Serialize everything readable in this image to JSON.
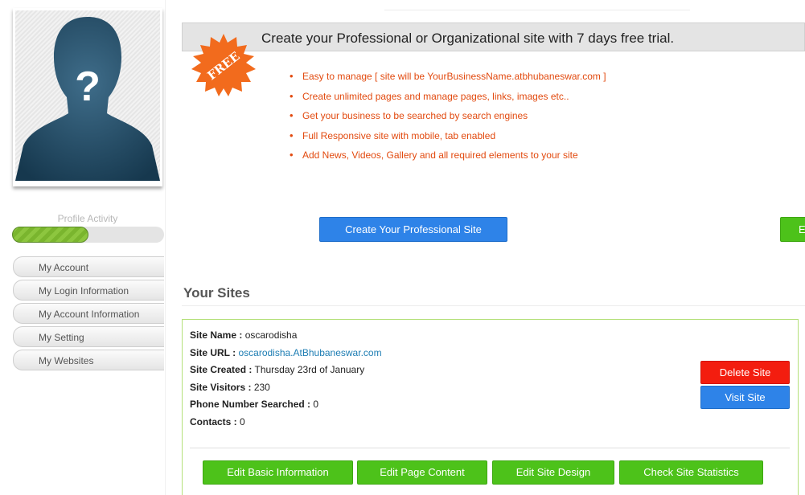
{
  "sidebar": {
    "profile_activity_label": "Profile Activity",
    "profile_activity_fraction": 0.5,
    "menu": [
      {
        "label": "My Account"
      },
      {
        "label": "My Login Information"
      },
      {
        "label": "My Account Information"
      },
      {
        "label": "My Setting"
      },
      {
        "label": "My Websites"
      }
    ]
  },
  "promo": {
    "title": "Create your Professional or Organizational site with 7 days free trial.",
    "badge": "FREE",
    "features": [
      "Easy to manage [ site will be YourBusinessName.atbhubaneswar.com ]",
      "Create unlimited pages and manage pages, links, images etc..",
      "Get your business to be searched by search engines",
      "Full Responsive site with mobile, tab enabled",
      "Add News, Videos, Gallery and all required elements to your site"
    ],
    "create_button": "Create Your Professional Site",
    "edge_button": "E"
  },
  "sites": {
    "heading": "Your Sites",
    "site": {
      "name_label": "Site Name :",
      "name": "oscarodisha",
      "url_label": "Site URL :",
      "url": "oscarodisha.AtBhubaneswar.com",
      "created_label": "Site Created :",
      "created": "Thursday 23rd of January",
      "visitors_label": "Site Visitors :",
      "visitors": "230",
      "phone_label": "Phone Number Searched :",
      "phone": "0",
      "contacts_label": "Contacts :",
      "contacts": "0"
    },
    "delete_button": "Delete Site",
    "visit_button": "Visit Site",
    "actions": {
      "edit_basic": "Edit Basic Information",
      "edit_content": "Edit Page Content",
      "edit_design": "Edit Site Design",
      "statistics": "Check Site Statistics"
    }
  },
  "colors": {
    "accent_blue": "#2e83e8",
    "accent_green": "#4dc21a",
    "danger_red": "#f31d0f",
    "feature_orange": "#e24a0f",
    "badge_orange": "#f26b1d"
  }
}
